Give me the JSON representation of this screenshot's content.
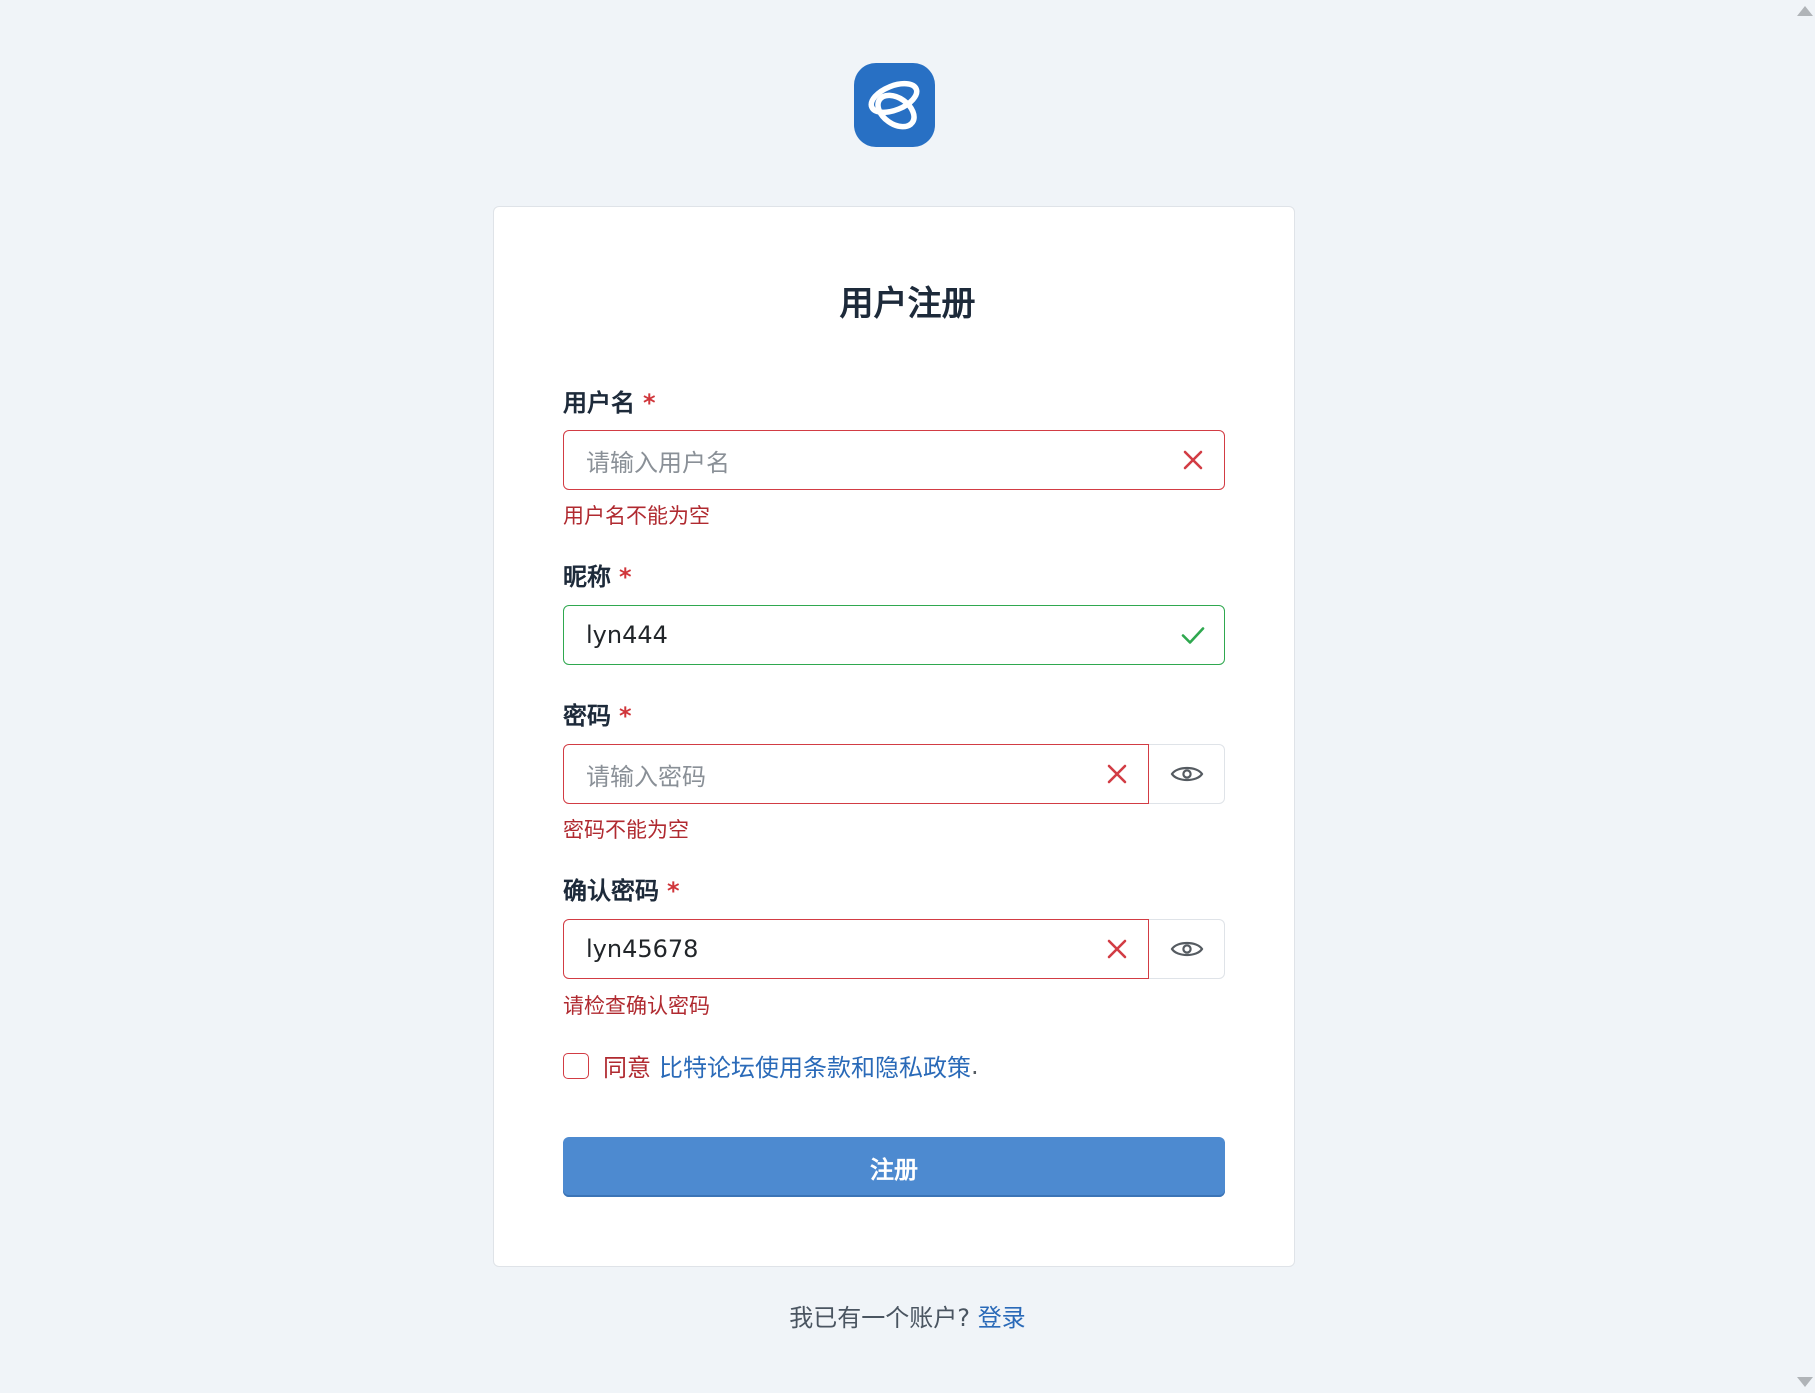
{
  "header": {
    "logo_icon": "swirl-logo-icon",
    "brand_color": "#2870c4"
  },
  "form": {
    "title": "用户注册",
    "required_marker": "*",
    "username": {
      "label": "用户名",
      "placeholder": "请输入用户名",
      "value": "",
      "state": "invalid",
      "state_icon": "x-icon",
      "error": "用户名不能为空"
    },
    "nickname": {
      "label": "昵称",
      "value": "lyn444",
      "state": "valid",
      "state_icon": "check-icon"
    },
    "password": {
      "label": "密码",
      "placeholder": "请输入密码",
      "value": "",
      "state": "invalid",
      "state_icon": "x-icon",
      "toggle_icon": "eye-icon",
      "error": "密码不能为空"
    },
    "confirm_password": {
      "label": "确认密码",
      "value": "lyn45678",
      "state": "invalid",
      "state_icon": "x-icon",
      "toggle_icon": "eye-icon",
      "error": "请检查确认密码"
    },
    "terms": {
      "checked": false,
      "agree_text": "同意",
      "link_text": "比特论坛使用条款和隐私政策",
      "suffix": "."
    },
    "submit_label": "注册"
  },
  "footer": {
    "prompt": "我已有一个账户?",
    "login_link": "登录"
  },
  "colors": {
    "error": "#d23c44",
    "success": "#2fa84f",
    "primary_button": "#4d8ad0",
    "link": "#2a6ab8"
  }
}
